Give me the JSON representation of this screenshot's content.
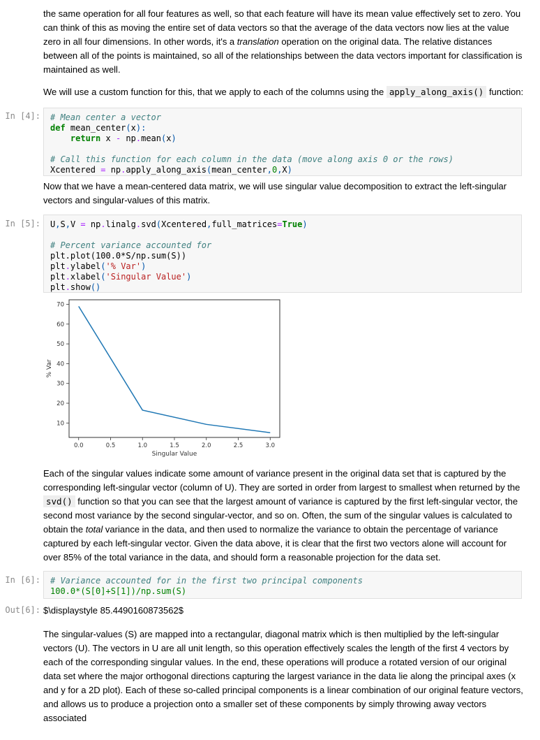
{
  "paragraphs": {
    "p1": {
      "before": "the same operation for all four features as well, so that each feature will have its mean value effectively set to zero. You can think of this as moving the entire set of data vectors so that the average of the data vectors now lies at the value zero in all four dimensions. In other words, it's a ",
      "em": "translation",
      "after": " operation on the original data. The relative distances between all of the points is maintained, so all of the relationships between the data vectors important for classification is maintained as well."
    },
    "p2": {
      "before": "We will use a custom function for this, that we apply to each of the columns using the ",
      "code": "apply_along_axis()",
      "after": " function:"
    },
    "p3": "Now that we have a mean-centered data matrix, we will use singular value decomposition to extract the left-singular vectors and singular-values of this matrix.",
    "p4": {
      "before": "Each of the singular values indicate some amount of variance present in the original data set that is captured by the corresponding left-singular vector (column of U). They are sorted in order from largest to smallest when returned by the ",
      "code": "svd()",
      "middle": " function so that you can see that the largest amount of variance is captured by the first left-singular vector, the second most variance by the second singular-vector, and so on. Often, the sum of the singular values is calculated to obtain the ",
      "em": "total",
      "after": " variance in the data, and then used to normalize the variance to obtain the percentage of variance captured by each left-singular vector. Given the data above, it is clear that the first two vectors alone will account for over 85% of the total variance in the data, and should form a reasonable projection for the data set."
    },
    "p5": "The singular-values (S) are mapped into a rectangular, diagonal matrix which is then multiplied by the left-singular vectors (U). The vectors in U are all unit length, so this operation effectively scales the length of the first 4 vectors by each of the corresponding singular values. In the end, these operations will produce a rotated version of our original data set where the major orthogonal directions capturing the largest variance in the data lie along the principal axes (x and y for a 2D plot). Each of these so-called principal components is a linear combination of our original feature vectors, and allows us to produce a projection onto a smaller set of these components by simply throwing away vectors associated"
  },
  "cells": {
    "in4": {
      "prompt": "In [4]:",
      "lines": {
        "l1": "# Mean center a vector",
        "l2_kw": "def",
        "l2_rest": " mean_center",
        "l2_p1": "(",
        "l2_arg": "x",
        "l2_p2": "):",
        "l3_kw": "return",
        "l3_a": " x ",
        "l3_op": "-",
        "l3_b": " np",
        "l3_dot": ".",
        "l3_c": "mean",
        "l3_p1": "(",
        "l3_d": "x",
        "l3_p2": ")",
        "l5": "# Call this function for each column in the data (move along axis 0 or the rows)",
        "l6_a": "Xcentered ",
        "l6_op": "=",
        "l6_b": " np",
        "l6_dot": ".",
        "l6_c": "apply_along_axis",
        "l6_p1": "(",
        "l6_d": "mean_center",
        "l6_comma1": ",",
        "l6_num": "0",
        "l6_comma2": ",",
        "l6_e": "X",
        "l6_p2": ")"
      }
    },
    "in5": {
      "prompt": "In [5]:",
      "lines": {
        "l1_a": "U",
        "l1_c1": ",",
        "l1_b": "S",
        "l1_c2": ",",
        "l1_c": "V ",
        "l1_op": "=",
        "l1_d": " np",
        "l1_dot1": ".",
        "l1_e": "linalg",
        "l1_dot2": ".",
        "l1_f": "svd",
        "l1_p1": "(",
        "l1_g": "Xcentered",
        "l1_c3": ",",
        "l1_h": "full_matrices",
        "l1_eq": "=",
        "l1_kw": "True",
        "l1_p2": ")",
        "l3": "# Percent variance accounted for",
        "l4": "plt.plot(100.0*S/np.sum(S))",
        "l5_a": "plt",
        "l5_b": "ylabel",
        "l5_s": "'% Var'",
        "l6_a": "plt",
        "l6_b": "xlabel",
        "l6_s": "'Singular Value'",
        "l7_a": "plt",
        "l7_b": "show"
      }
    },
    "in6": {
      "prompt": "In [6]:",
      "line1": "# Variance accounted for in the first two principal components",
      "line2": "100.0*(S[0]+S[1])/np.sum(S)"
    },
    "out6": {
      "prompt": "Out[6]:",
      "value": "$\\displaystyle 85.4490160873562$"
    }
  },
  "chart_data": {
    "type": "line",
    "title": "",
    "xlabel": "Singular Value",
    "ylabel": "% Var",
    "x": [
      0,
      1,
      2,
      3
    ],
    "series": [
      {
        "name": "percent variance",
        "values": [
          69.0,
          16.5,
          9.3,
          5.1
        ],
        "color": "#1f77b4"
      }
    ],
    "xlim": [
      -0.15,
      3.15
    ],
    "ylim": [
      2.7,
      72.3
    ],
    "xticks": [
      0.0,
      0.5,
      1.0,
      1.5,
      2.0,
      2.5,
      3.0
    ],
    "xtick_labels": [
      "0.0",
      "0.5",
      "1.0",
      "1.5",
      "2.0",
      "2.5",
      "3.0"
    ],
    "yticks": [
      10,
      20,
      30,
      40,
      50,
      60,
      70
    ],
    "ytick_labels": [
      "10",
      "20",
      "30",
      "40",
      "50",
      "60",
      "70"
    ],
    "grid": false,
    "legend": "none"
  }
}
